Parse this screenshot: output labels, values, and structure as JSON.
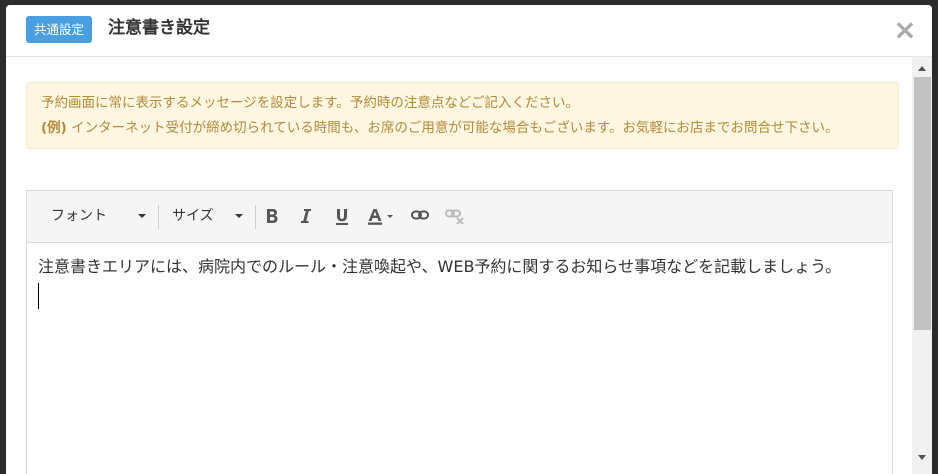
{
  "header": {
    "badge": "共通設定",
    "title": "注意書き設定",
    "close": "×"
  },
  "alert": {
    "line1": "予約画面に常に表示するメッセージを設定します。予約時の注意点などご記入ください。",
    "example_prefix": "(例)",
    "example_text": " インターネット受付が締め切られている時間も、お席のご用意が可能な場合もございます。お気軽にお店までお問合せ下さい。"
  },
  "toolbar": {
    "font_label": "フォント",
    "size_label": "サイズ",
    "buttons": [
      "bold-icon",
      "italic-icon",
      "underline-icon",
      "text-color-icon",
      "link-icon",
      "unlink-icon"
    ]
  },
  "editor": {
    "content": "注意書きエリアには、病院内でのルール・注意喚起や、WEB予約に関するお知らせ事項などを記載しましょう。"
  },
  "colors": {
    "badge": "#4a9fe3",
    "alert_bg": "#fcf6e2",
    "alert_text": "#b48b3b"
  }
}
